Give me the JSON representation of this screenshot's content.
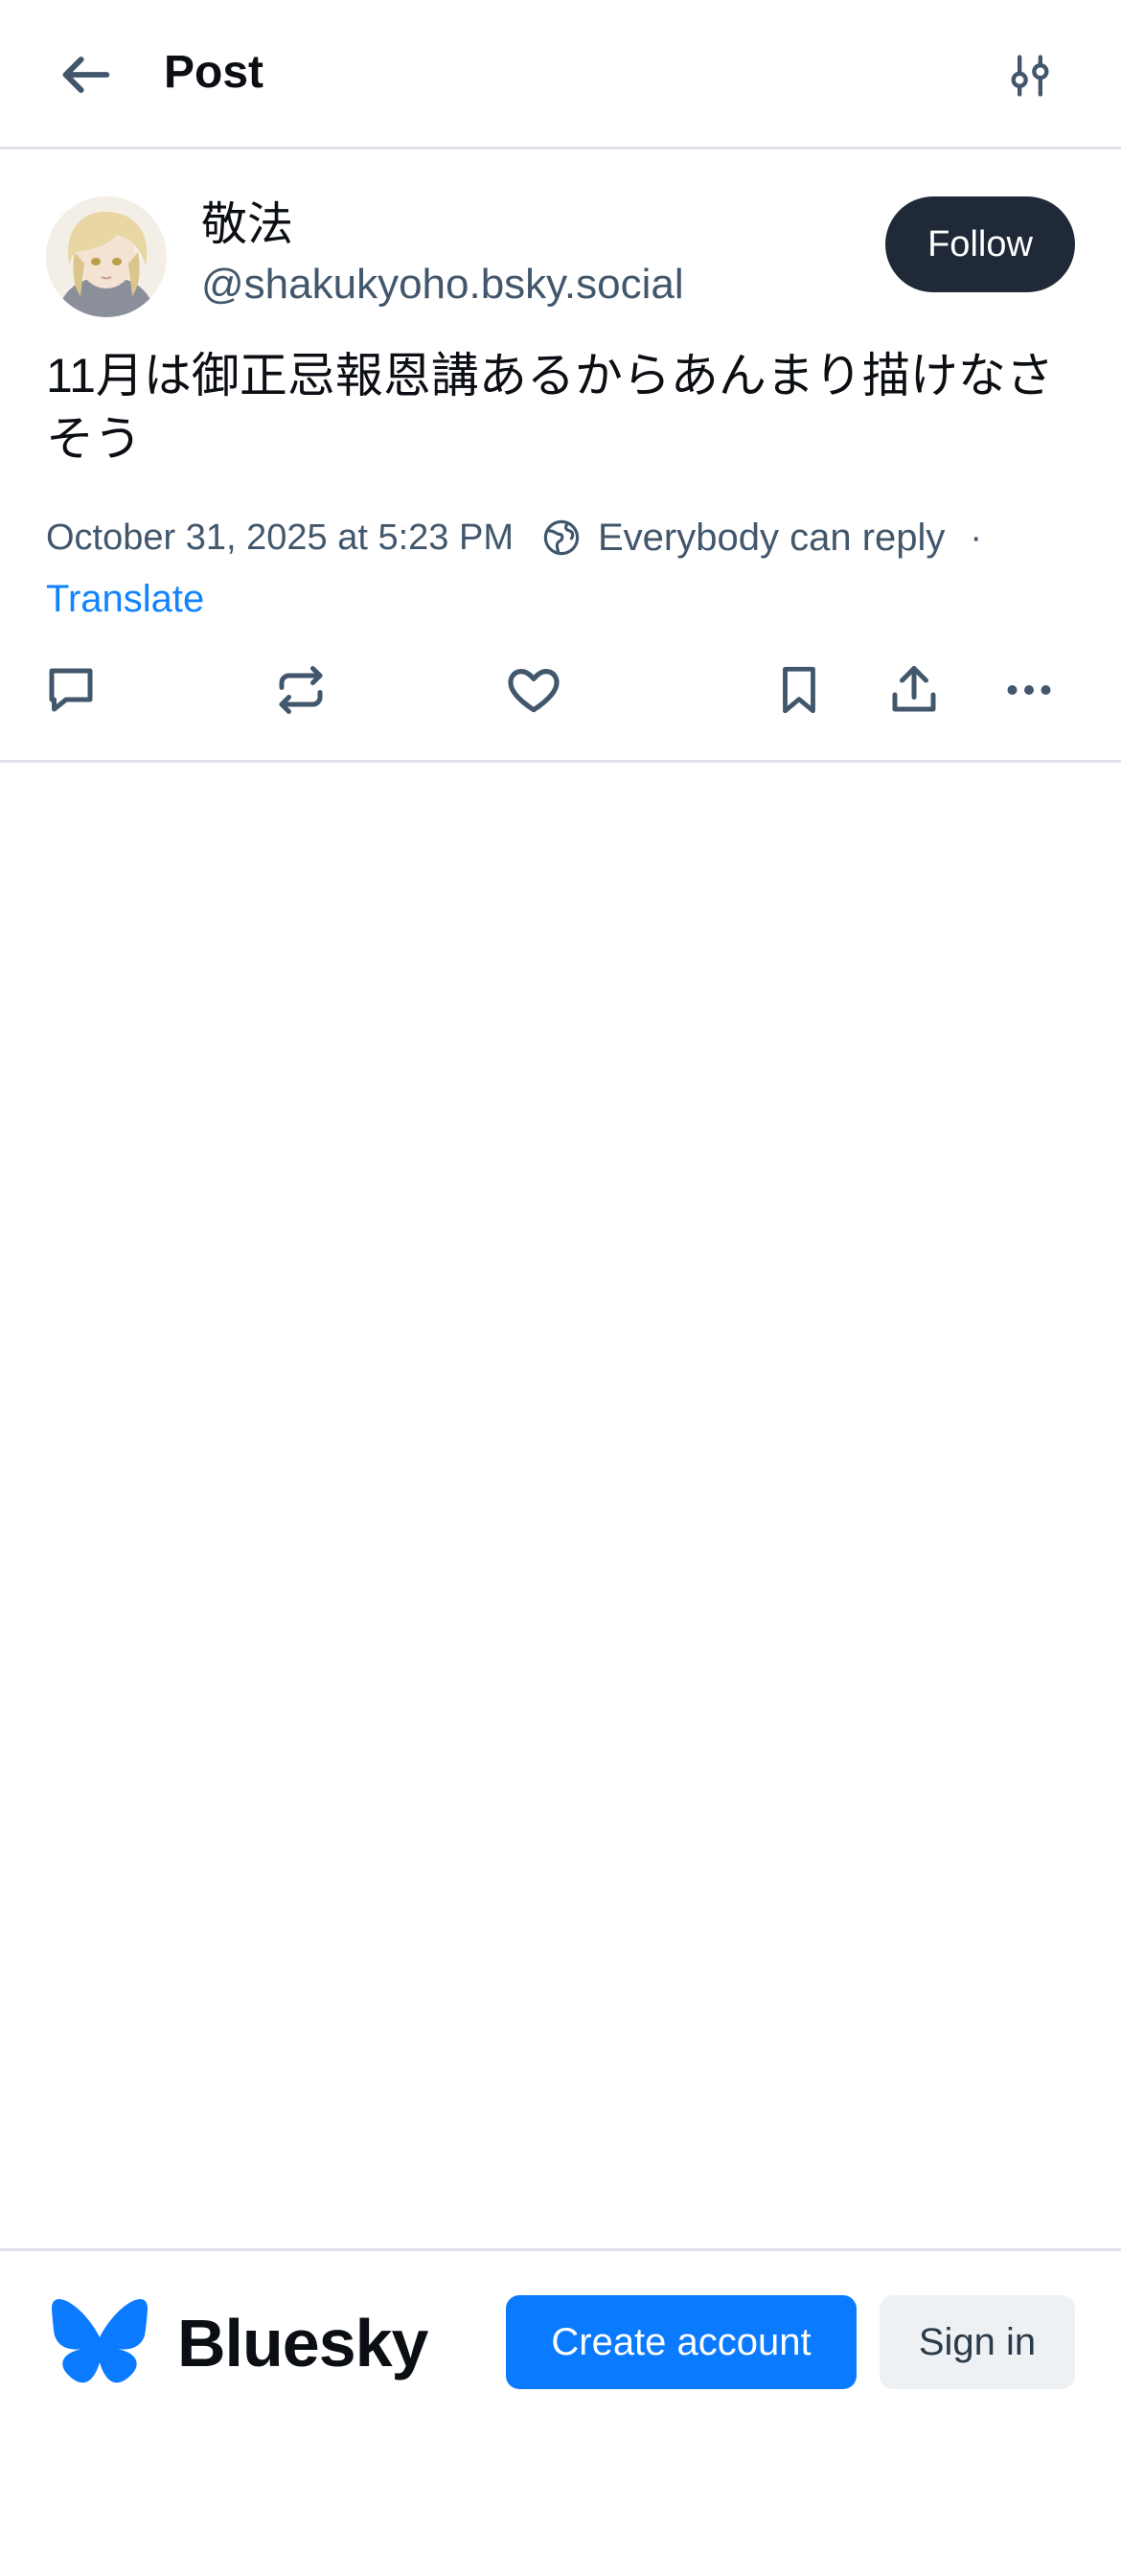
{
  "header": {
    "title": "Post",
    "back_icon": "arrow-left-icon",
    "settings_icon": "sliders-icon"
  },
  "post": {
    "author": {
      "display_name": "敬法",
      "handle": "@shakukyoho.bsky.social",
      "avatar": "avatar-image"
    },
    "follow_label": "Follow",
    "text": "11月は御正忌報恩講あるからあんまり描けなさそう",
    "timestamp": "October 31, 2025 at 5:23 PM",
    "reply_setting": "Everybody can reply",
    "meta_separator": "·",
    "translate_label": "Translate",
    "actions": [
      "reply-icon",
      "repost-icon",
      "like-icon",
      "bookmark-icon",
      "share-icon",
      "more-icon"
    ]
  },
  "footer": {
    "brand": "Bluesky",
    "create_account_label": "Create account",
    "sign_in_label": "Sign in"
  },
  "colors": {
    "accent": "#0a7aff",
    "link": "#1083fe",
    "muted_text": "#42576c",
    "follow_button": "#1f2937",
    "divider": "#dfe3e8"
  }
}
